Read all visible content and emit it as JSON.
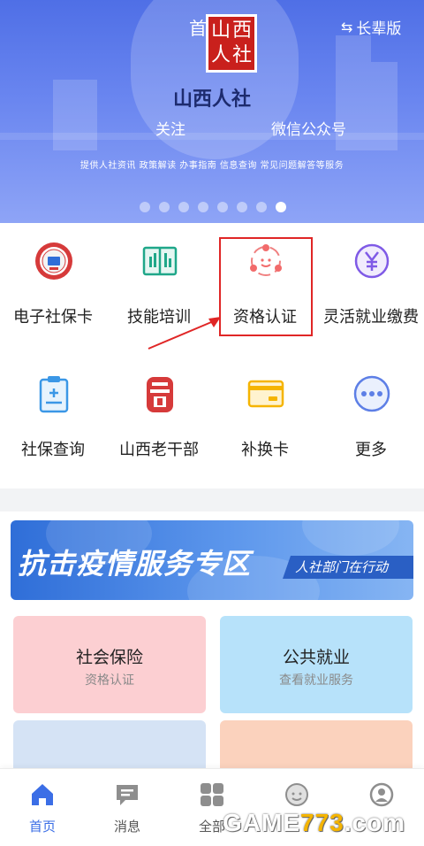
{
  "banner": {
    "page_title": "首",
    "elder_mode": {
      "label": "长辈版",
      "icon": "swap-arrows-icon"
    },
    "seal_text": [
      "山",
      "西",
      "人",
      "社"
    ],
    "brand": "山西人社",
    "follow": "关注",
    "wechat": "微信公众号",
    "slogan": "提供人社资讯  政策解读  办事指南  信息查询  常见问题解答等服务",
    "carousel": {
      "total": 8,
      "active": 8
    }
  },
  "services": [
    {
      "label": "电子社保卡",
      "icon": "social-security-card-icon"
    },
    {
      "label": "技能培训",
      "icon": "skills-book-icon"
    },
    {
      "label": "资格认证",
      "icon": "qualification-people-icon"
    },
    {
      "label": "灵活就业缴费",
      "icon": "yuan-payment-icon"
    },
    {
      "label": "社保查询",
      "icon": "clipboard-query-icon"
    },
    {
      "label": "山西老干部",
      "icon": "veteran-cadre-icon"
    },
    {
      "label": "补换卡",
      "icon": "card-replace-icon"
    },
    {
      "label": "更多",
      "icon": "more-dots-icon"
    }
  ],
  "promo": {
    "title": "抗击疫情服务专区",
    "tag": "人社部门在行动"
  },
  "cards": [
    {
      "title": "社会保险",
      "subtitle": "资格认证"
    },
    {
      "title": "公共就业",
      "subtitle": "查看就业服务"
    }
  ],
  "tabs": [
    {
      "label": "首页",
      "icon": "home-icon",
      "active": true
    },
    {
      "label": "消息",
      "icon": "message-icon",
      "active": false
    },
    {
      "label": "全部",
      "icon": "grid-icon",
      "active": false
    },
    {
      "label": "",
      "icon": "service-face-icon",
      "active": false
    },
    {
      "label": "",
      "icon": "profile-icon",
      "active": false
    }
  ],
  "watermark": {
    "text_a": "GAME",
    "text_b": "773",
    "text_c": ".com"
  },
  "colors": {
    "accent": "#3b6ee6",
    "banner": "#5a77ea",
    "highlight": "#e02626"
  }
}
